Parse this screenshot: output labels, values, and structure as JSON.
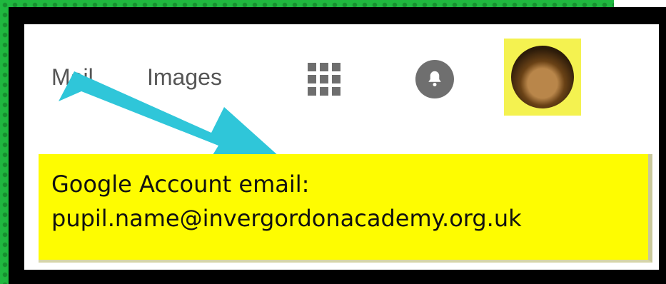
{
  "header": {
    "links": [
      {
        "label": "Mail"
      },
      {
        "label": "Images"
      }
    ]
  },
  "icons": {
    "apps": "apps-grid-icon",
    "notifications": "bell-icon",
    "account": "avatar"
  },
  "callout": {
    "line1": "Google Account email:",
    "line2": "pupil.name@invergordonacademy.org.uk"
  },
  "colors": {
    "background": "#1fb83f",
    "frame": "#000000",
    "callout": "#fefc01",
    "arrow": "#2fc6d9",
    "avatar_highlight": "#f4f250"
  }
}
